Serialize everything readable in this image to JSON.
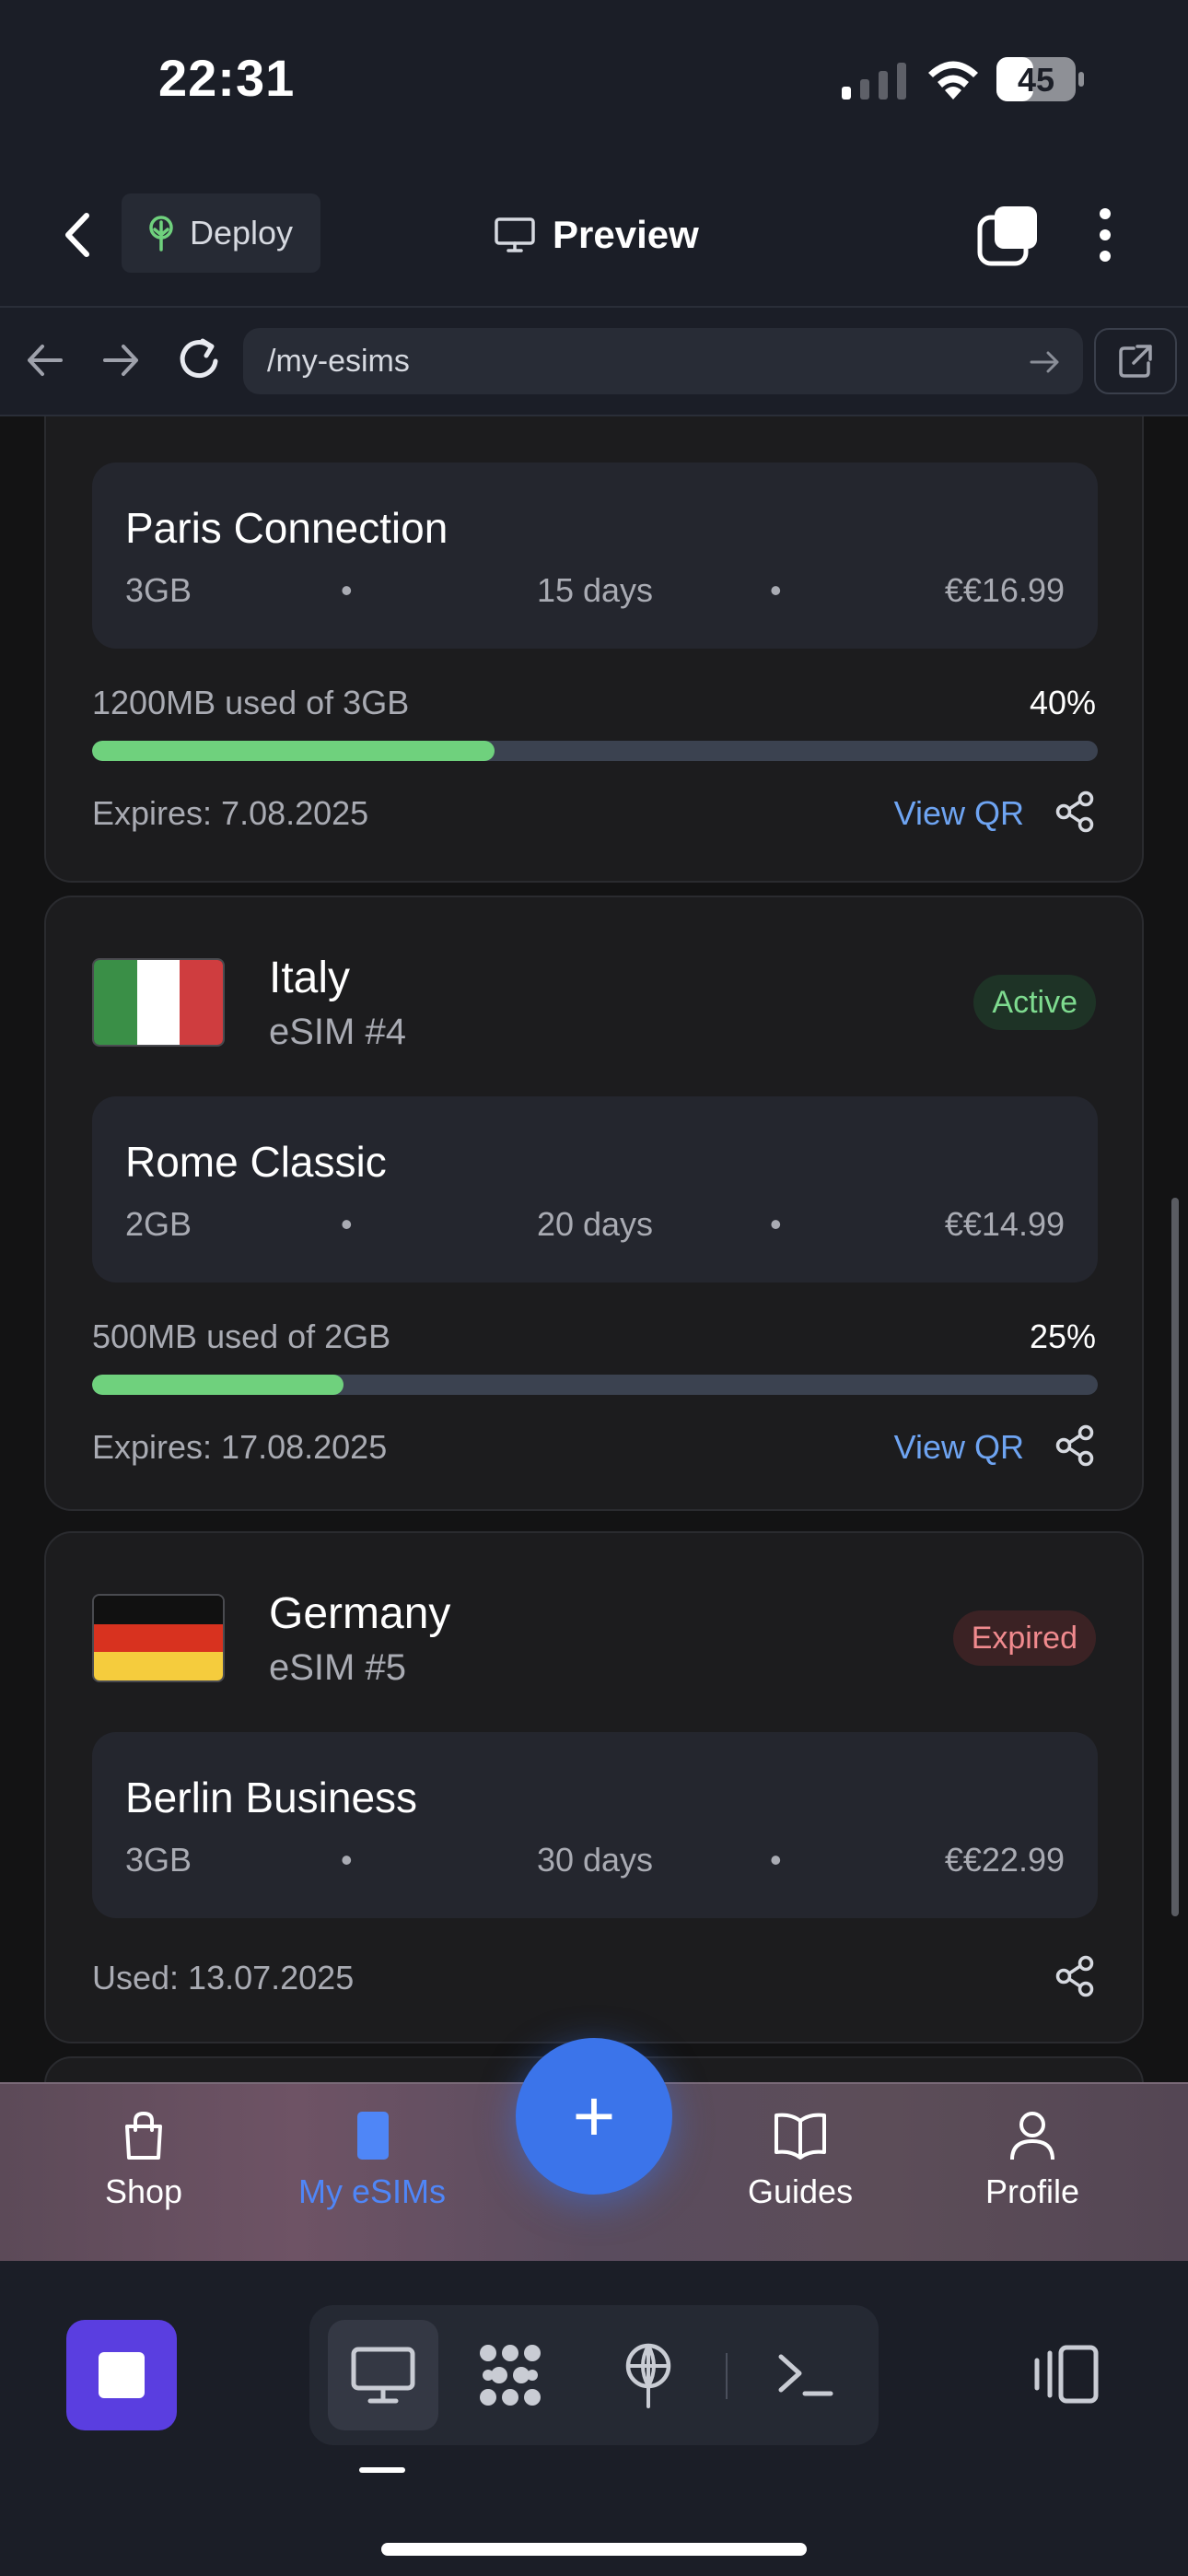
{
  "status_bar": {
    "time": "22:31",
    "battery": "45"
  },
  "top_nav": {
    "deploy_label": "Deploy",
    "title": "Preview"
  },
  "browser": {
    "url": "/my-esims"
  },
  "esims": [
    {
      "plan": {
        "name": "Paris Connection",
        "data": "3GB",
        "duration": "15 days",
        "price": "€€16.99"
      },
      "usage_text": "1200MB used of 3GB",
      "usage_percent_label": "40%",
      "usage_fraction": 0.4,
      "footer_text": "Expires: 7.08.2025",
      "view_qr": "View QR"
    },
    {
      "country": "Italy",
      "esim_label": "eSIM #4",
      "status": "Active",
      "flag_colors": [
        "#3a8f47",
        "#ffffff",
        "#cf3d3f"
      ],
      "plan": {
        "name": "Rome Classic",
        "data": "2GB",
        "duration": "20 days",
        "price": "€€14.99"
      },
      "usage_text": "500MB used of 2GB",
      "usage_percent_label": "25%",
      "usage_fraction": 0.25,
      "footer_text": "Expires: 17.08.2025",
      "view_qr": "View QR"
    },
    {
      "country": "Germany",
      "esim_label": "eSIM #5",
      "status": "Expired",
      "flag_colors": [
        "#111111",
        "#d8321f",
        "#f5cc3d"
      ],
      "plan": {
        "name": "Berlin Business",
        "data": "3GB",
        "duration": "30 days",
        "price": "€€22.99"
      },
      "footer_text": "Used: 13.07.2025"
    }
  ],
  "tab_bar": {
    "tabs": [
      {
        "label": "Shop",
        "icon": "shopping-bag-icon",
        "active": false
      },
      {
        "label": "My eSIMs",
        "icon": "esim-card-icon",
        "active": true
      },
      {
        "label": "Guides",
        "icon": "book-icon",
        "active": false
      },
      {
        "label": "Profile",
        "icon": "user-icon",
        "active": false
      }
    ],
    "fab_label": "+"
  },
  "colors": {
    "accent": "#3b74ea",
    "progress": "#6fd17d",
    "link": "#6ea4f2",
    "active_badge": "#7edb8f",
    "expired_badge": "#f08a8e"
  }
}
